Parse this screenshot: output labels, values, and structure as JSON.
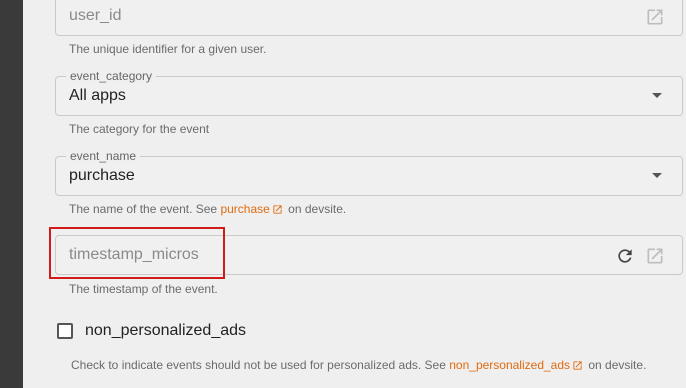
{
  "user_id": {
    "placeholder": "user_id",
    "help": "The unique identifier for a given user."
  },
  "event_category": {
    "legend": "event_category",
    "value": "All apps",
    "help": "The category for the event"
  },
  "event_name": {
    "legend": "event_name",
    "value": "purchase",
    "help_prefix": "The name of the event. See",
    "help_link": "purchase",
    "help_suffix": "on devsite."
  },
  "timestamp_micros": {
    "placeholder": "timestamp_micros",
    "help": "The timestamp of the event."
  },
  "non_personalized_ads": {
    "label": "non_personalized_ads",
    "checked": false,
    "help_prefix": "Check to indicate events should not be used for personalized ads. See",
    "help_link": "non_personalized_ads",
    "help_suffix": "on devsite."
  },
  "colors": {
    "link": "#e06b0f",
    "highlight": "#d21a1a"
  }
}
